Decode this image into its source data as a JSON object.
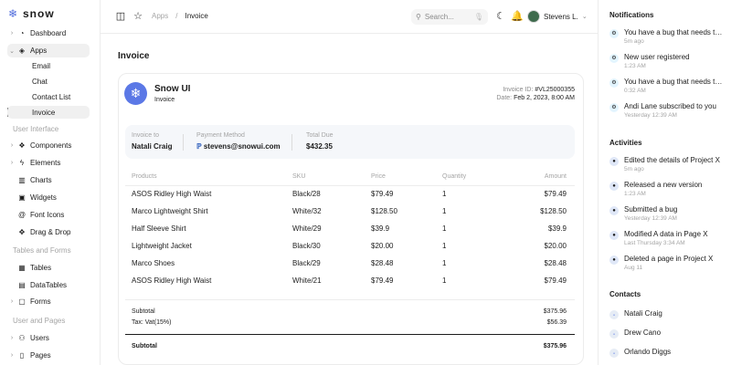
{
  "app": {
    "logo_text": "snow"
  },
  "sidebar": {
    "dashboard": "Dashboard",
    "apps": "Apps",
    "apps_children": [
      "Email",
      "Chat",
      "Contact List",
      "Invoice"
    ],
    "section_ui": "User Interface",
    "ui_items": [
      "Components",
      "Elements",
      "Charts",
      "Widgets",
      "Font Icons",
      "Drag & Drop"
    ],
    "section_tables": "Tables and Forms",
    "table_items": [
      "Tables",
      "DataTables",
      "Forms"
    ],
    "section_pages": "User and Pages",
    "page_items": [
      "Users",
      "Pages"
    ]
  },
  "topbar": {
    "breadcrumb_root": "Apps",
    "breadcrumb_sep": "/",
    "breadcrumb_current": "Invoice",
    "search_placeholder": "Search...",
    "user_name": "Stevens L."
  },
  "invoice": {
    "page_title": "Invoice",
    "brand_name": "Snow UI",
    "brand_sub": "Invoice",
    "id_label": "Invoice ID:",
    "id_value": "#VL25000355",
    "date_label": "Date:",
    "date_value": "Feb 2, 2023, 8:00 AM",
    "invoice_to_label": "Invoice to",
    "invoice_to_value": "Natali Craig",
    "payment_label": "Payment Method",
    "payment_value": "stevens@snowui.com",
    "total_due_label": "Total Due",
    "total_due_value": "$432.35",
    "headers": [
      "Products",
      "SKU",
      "Price",
      "Quantity",
      "Amount"
    ],
    "rows": [
      [
        "ASOS Ridley High Waist",
        "Black/28",
        "$79.49",
        "1",
        "$79.49"
      ],
      [
        "Marco Lightweight Shirt",
        "White/32",
        "$128.50",
        "1",
        "$128.50"
      ],
      [
        "Half Sleeve Shirt",
        "White/29",
        "$39.9",
        "1",
        "$39.9"
      ],
      [
        "Lightweight Jacket",
        "Black/30",
        "$20.00",
        "1",
        "$20.00"
      ],
      [
        "Marco Shoes",
        "Black/29",
        "$28.48",
        "1",
        "$28.48"
      ],
      [
        "ASOS Ridley High Waist",
        "White/21",
        "$79.49",
        "1",
        "$79.49"
      ]
    ],
    "subtotal_label": "Subtotal",
    "subtotal_value": "$375.96",
    "tax_label": "Tax: Vat(15%)",
    "tax_value": "$56.39",
    "grand_label": "Subtotal",
    "grand_value": "$375.96"
  },
  "notifications": {
    "title": "Notifications",
    "items": [
      {
        "text": "You have a bug that needs to be fixed",
        "time": "5m ago"
      },
      {
        "text": "New user registered",
        "time": "1:23 AM"
      },
      {
        "text": "You have a bug that needs to be fixed",
        "time": "0:32 AM"
      },
      {
        "text": "Andi Lane subscribed to you",
        "time": "Yesterday 12:39 AM"
      }
    ]
  },
  "activities": {
    "title": "Activities",
    "items": [
      {
        "text": "Edited the details of Project X",
        "time": "5m ago"
      },
      {
        "text": "Released a new version",
        "time": "1:23 AM"
      },
      {
        "text": "Submitted a bug",
        "time": "Yesterday 12:39 AM"
      },
      {
        "text": "Modified A data in Page X",
        "time": "Last Thursday 3:34 AM"
      },
      {
        "text": "Deleted a page in Project X",
        "time": "Aug 11"
      }
    ]
  },
  "contacts": {
    "title": "Contacts",
    "items": [
      "Natali Craig",
      "Drew Cano",
      "Orlando Diggs"
    ]
  },
  "colors": {
    "accent": "#5b78e6",
    "bill_bg": "#f5f7fa",
    "active_bg": "#f0f0f0"
  }
}
